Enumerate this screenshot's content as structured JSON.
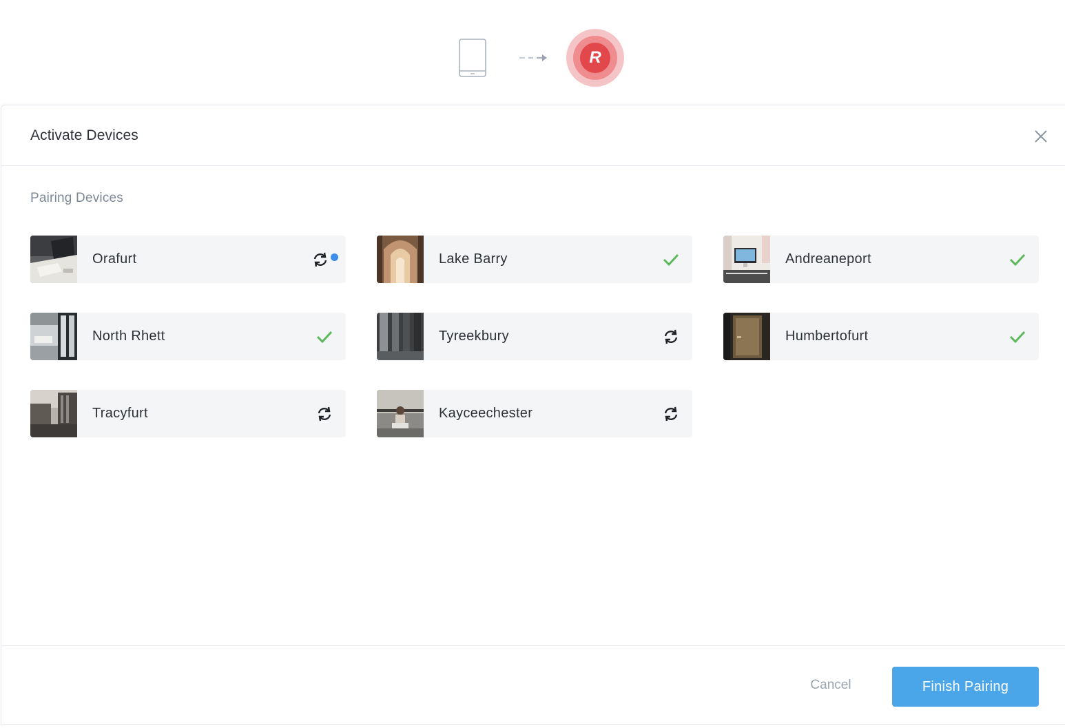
{
  "header": {
    "illustration": {
      "source_icon": "tablet-icon",
      "connector_icon": "dashed-arrow-icon",
      "target_logo_letter": "R",
      "logo_color": "#e2474c"
    }
  },
  "modal": {
    "title": "Activate Devices",
    "close_icon": "close-icon",
    "section_label": "Pairing Devices",
    "devices": [
      {
        "name": "Orafurt",
        "status": "syncing",
        "new_indicator": true,
        "thumb": "office-desk-photo"
      },
      {
        "name": "Lake Barry",
        "status": "paired",
        "new_indicator": false,
        "thumb": "hallway-photo"
      },
      {
        "name": "Andreaneport",
        "status": "paired",
        "new_indicator": false,
        "thumb": "imac-desk-photo"
      },
      {
        "name": "North Rhett",
        "status": "paired",
        "new_indicator": false,
        "thumb": "glass-office-photo"
      },
      {
        "name": "Tyreekbury",
        "status": "syncing",
        "new_indicator": false,
        "thumb": "pillars-photo"
      },
      {
        "name": "Humbertofurt",
        "status": "paired",
        "new_indicator": false,
        "thumb": "door-photo"
      },
      {
        "name": "Tracyfurt",
        "status": "syncing",
        "new_indicator": false,
        "thumb": "city-street-photo"
      },
      {
        "name": "Kayceechester",
        "status": "syncing",
        "new_indicator": false,
        "thumb": "person-laptop-photo"
      }
    ]
  },
  "footer": {
    "cancel_label": "Cancel",
    "finish_label": "Finish Pairing"
  },
  "colors": {
    "check": "#5cb85c",
    "sync": "#1f2328",
    "indicator_dot": "#3b8eea",
    "primary_button": "#4aa6e8",
    "card_bg": "#f4f5f7"
  }
}
